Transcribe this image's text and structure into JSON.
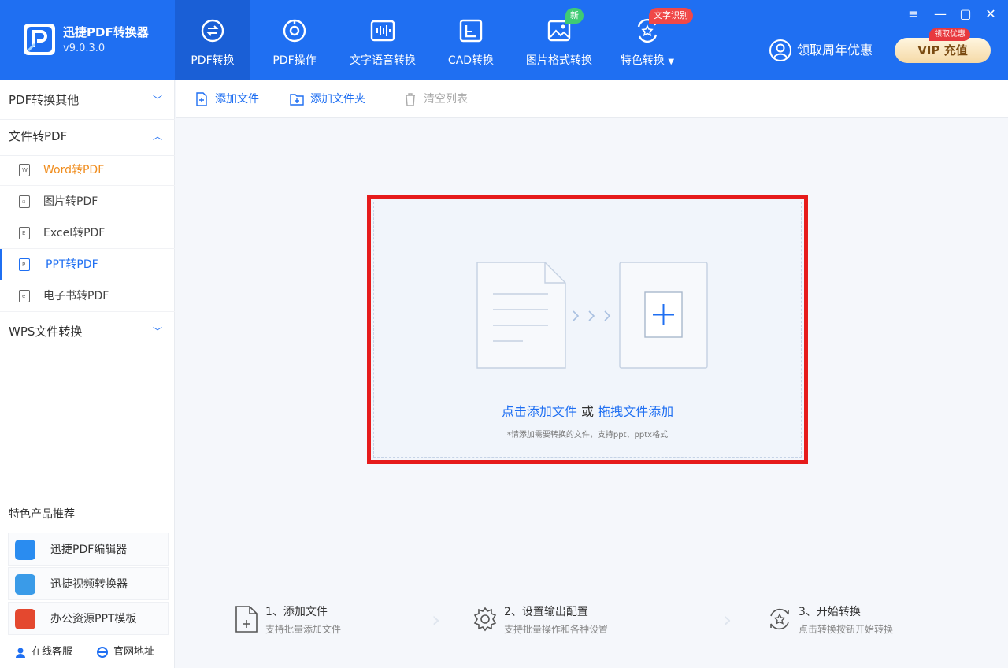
{
  "app": {
    "title": "迅捷PDF转换器",
    "version": "v9.0.3.0"
  },
  "nav": [
    {
      "label": "PDF转换",
      "icon": "pdf-convert-icon",
      "active": true
    },
    {
      "label": "PDF操作",
      "icon": "pdf-operate-icon"
    },
    {
      "label": "文字语音转换",
      "icon": "voice-icon"
    },
    {
      "label": "CAD转换",
      "icon": "cad-icon"
    },
    {
      "label": "图片格式转换",
      "icon": "image-icon",
      "badge": "新"
    },
    {
      "label": "特色转换",
      "icon": "special-icon",
      "badge": "文字识别"
    }
  ],
  "header": {
    "promo": "领取周年优惠",
    "vip_label": "VIP 充值",
    "vip_tag": "领取优惠"
  },
  "window": {
    "menu": "≡",
    "minimize": "—",
    "maximize": "▢",
    "close": "✕"
  },
  "sidebar": {
    "sections": [
      {
        "label": "PDF转换其他",
        "expanded": false
      },
      {
        "label": "文件转PDF",
        "expanded": true
      },
      {
        "label": "WPS文件转换",
        "expanded": false
      }
    ],
    "items": [
      {
        "label": "Word转PDF",
        "glyph": "W"
      },
      {
        "label": "图片转PDF",
        "glyph": "▫"
      },
      {
        "label": "Excel转PDF",
        "glyph": "E"
      },
      {
        "label": "PPT转PDF",
        "glyph": "P",
        "active": true
      },
      {
        "label": "电子书转PDF",
        "glyph": "e"
      }
    ],
    "rec_title": "特色产品推荐",
    "recs": [
      {
        "label": "迅捷PDF编辑器",
        "color": "#2a8cf0"
      },
      {
        "label": "迅捷视频转换器",
        "color": "#3a9be8"
      },
      {
        "label": "办公资源PPT模板",
        "color": "#e4482f"
      }
    ],
    "footer": {
      "support": "在线客服",
      "website": "官网地址"
    }
  },
  "toolbar": {
    "add_file": "添加文件",
    "add_folder": "添加文件夹",
    "clear_list": "清空列表"
  },
  "dropzone": {
    "click_add": "点击添加文件",
    "or": "或",
    "drag_add": "拖拽文件添加",
    "hint": "*请添加需要转换的文件，支持ppt、pptx格式"
  },
  "steps": [
    {
      "title": "1、添加文件",
      "desc": "支持批量添加文件",
      "icon": "add-file-icon"
    },
    {
      "title": "2、设置输出配置",
      "desc": "支持批量操作和各种设置",
      "icon": "settings-icon"
    },
    {
      "title": "3、开始转换",
      "desc": "点击转换按钮开始转换",
      "icon": "convert-icon"
    }
  ],
  "colors": {
    "primary": "#1f6ff2",
    "highlight": "#e61b1b",
    "orange": "#f08d1e"
  }
}
